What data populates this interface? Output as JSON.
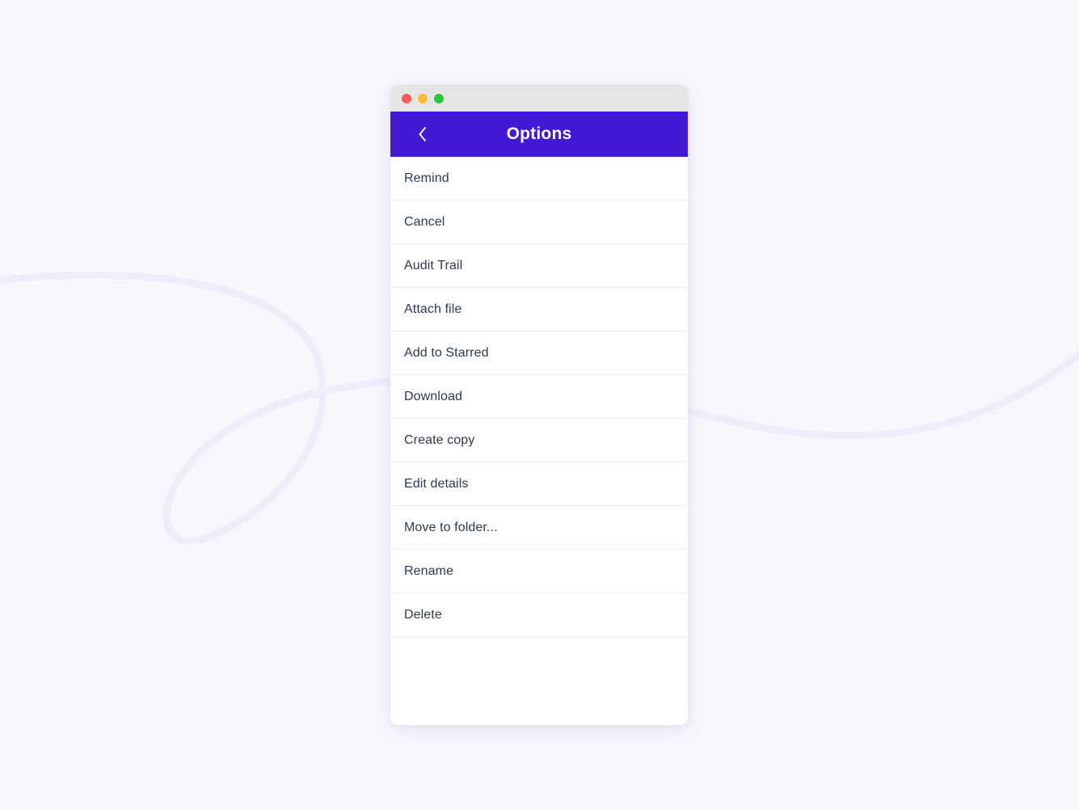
{
  "page": {
    "background_color": "#f8f7fd",
    "decor_line_color": "#f0edfb"
  },
  "window": {
    "titlebar": {
      "background_color": "#e5e5e5",
      "traffic_lights": [
        {
          "name": "close",
          "color": "#fc5b57"
        },
        {
          "name": "minimize",
          "color": "#fdbc2e"
        },
        {
          "name": "maximize",
          "color": "#28c840"
        }
      ]
    },
    "header": {
      "title": "Options",
      "background_color": "#4318d5",
      "text_color": "#ffffff",
      "back_icon": "chevron-left-icon"
    },
    "options": {
      "items": [
        {
          "label": "Remind"
        },
        {
          "label": "Cancel"
        },
        {
          "label": "Audit Trail"
        },
        {
          "label": "Attach file"
        },
        {
          "label": "Add to Starred"
        },
        {
          "label": "Download"
        },
        {
          "label": "Create copy"
        },
        {
          "label": "Edit details"
        },
        {
          "label": "Move to folder..."
        },
        {
          "label": "Rename"
        },
        {
          "label": "Delete"
        }
      ],
      "text_color": "#2e3a4f",
      "separator_color": "#eeeef2",
      "background_color": "#ffffff"
    }
  }
}
